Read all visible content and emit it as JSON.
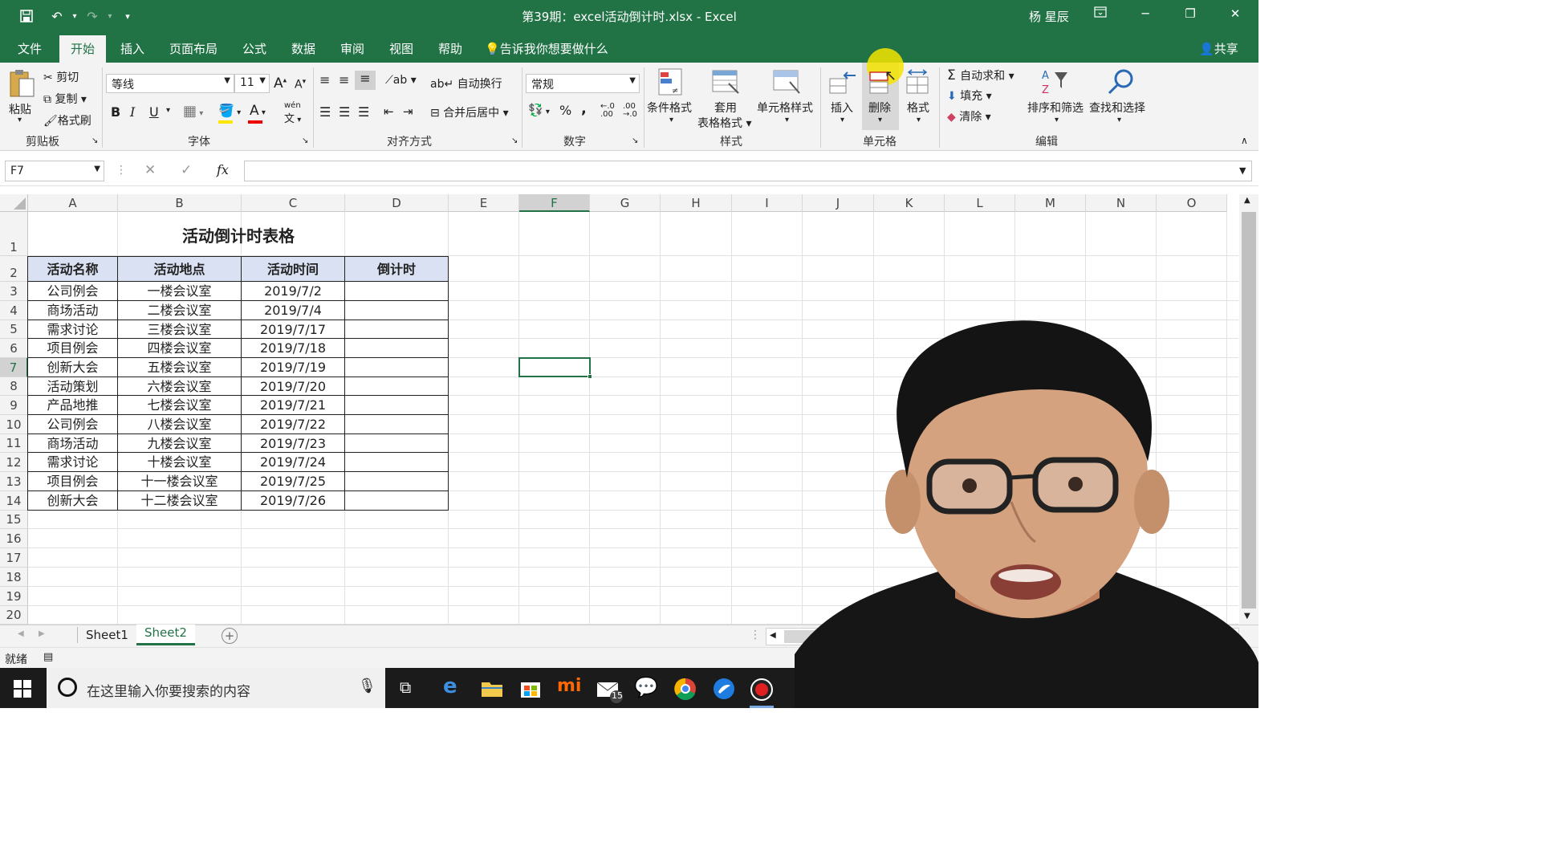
{
  "window": {
    "title": "第39期：excel活动倒计时.xlsx  -  Excel",
    "user": "杨 星辰"
  },
  "menu": {
    "tabs": [
      "文件",
      "开始",
      "插入",
      "页面布局",
      "公式",
      "数据",
      "审阅",
      "视图",
      "帮助"
    ],
    "active": "开始",
    "tellme": "告诉我你想要做什么",
    "share": "共享"
  },
  "ribbon": {
    "clipboard": {
      "paste": "粘贴",
      "cut": "剪切",
      "copy": "复制",
      "format_painter": "格式刷",
      "group": "剪贴板"
    },
    "font": {
      "name": "等线",
      "size": "11",
      "bold": "B",
      "italic": "I",
      "underline": "U",
      "phonetic": "wén",
      "group": "字体"
    },
    "align": {
      "wrap": "自动换行",
      "merge": "合并后居中",
      "group": "对齐方式"
    },
    "number": {
      "format": "常规",
      "percent": "%",
      "comma": ",",
      "group": "数字"
    },
    "styles": {
      "conditional": "条件格式",
      "table_format_1": "套用",
      "table_format_2": "表格格式",
      "cell_styles": "单元格样式",
      "group": "样式"
    },
    "cells": {
      "insert": "插入",
      "delete": "删除",
      "format": "格式",
      "group": "单元格"
    },
    "editing": {
      "autosum": "自动求和",
      "fill": "填充",
      "clear": "清除",
      "sort_filter": "排序和筛选",
      "find_select": "查找和选择",
      "group": "编辑"
    }
  },
  "formula_bar": {
    "name_box": "F7",
    "formula": ""
  },
  "sheet": {
    "columns": [
      "A",
      "B",
      "C",
      "D",
      "E",
      "F",
      "G",
      "H",
      "I",
      "J",
      "K",
      "L",
      "M",
      "N",
      "O"
    ],
    "rows": [
      "1",
      "2",
      "3",
      "4",
      "5",
      "6",
      "7",
      "8",
      "9",
      "10",
      "11",
      "12",
      "13",
      "14",
      "15",
      "16",
      "17",
      "18",
      "19",
      "20"
    ],
    "active_cell": "F7",
    "title": "活动倒计时表格",
    "headers": [
      "活动名称",
      "活动地点",
      "活动时间",
      "倒计时"
    ],
    "data": [
      [
        "公司例会",
        "一楼会议室",
        "2019/7/2",
        ""
      ],
      [
        "商场活动",
        "二楼会议室",
        "2019/7/4",
        ""
      ],
      [
        "需求讨论",
        "三楼会议室",
        "2019/7/17",
        ""
      ],
      [
        "项目例会",
        "四楼会议室",
        "2019/7/18",
        ""
      ],
      [
        "创新大会",
        "五楼会议室",
        "2019/7/19",
        ""
      ],
      [
        "活动策划",
        "六楼会议室",
        "2019/7/20",
        ""
      ],
      [
        "产品地推",
        "七楼会议室",
        "2019/7/21",
        ""
      ],
      [
        "公司例会",
        "八楼会议室",
        "2019/7/22",
        ""
      ],
      [
        "商场活动",
        "九楼会议室",
        "2019/7/23",
        ""
      ],
      [
        "需求讨论",
        "十楼会议室",
        "2019/7/24",
        ""
      ],
      [
        "项目例会",
        "十一楼会议室",
        "2019/7/25",
        ""
      ],
      [
        "创新大会",
        "十二楼会议室",
        "2019/7/26",
        ""
      ]
    ]
  },
  "sheet_tabs": {
    "tabs": [
      "Sheet1",
      "Sheet2"
    ],
    "active": "Sheet2"
  },
  "status": {
    "ready": "就绪"
  },
  "taskbar": {
    "search_placeholder": "在这里输入你要搜索的内容",
    "mail_badge": "15"
  },
  "colors": {
    "excel_green": "#217346",
    "header_fill": "#d9e1f2",
    "selection": "#217346",
    "cursor_highlight": "#f5e400"
  }
}
